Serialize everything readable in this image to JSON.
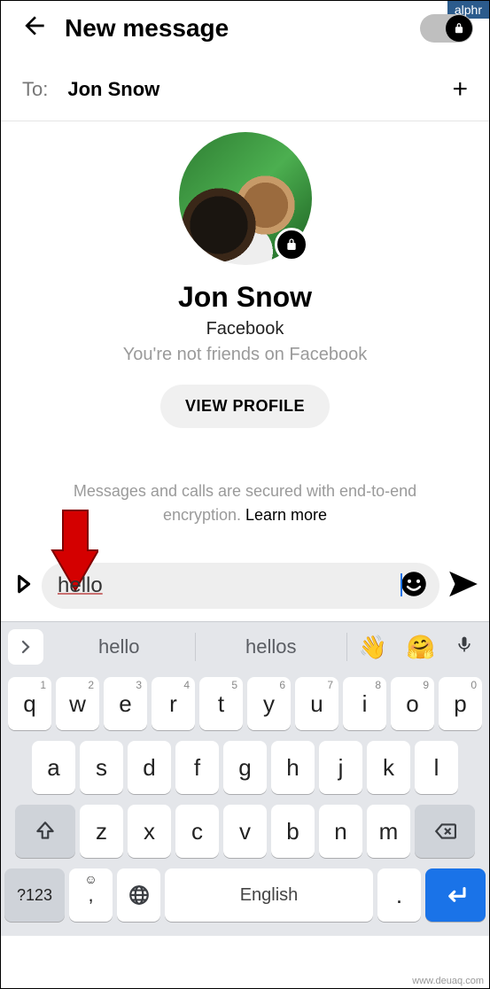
{
  "overlay": {
    "brand": "alphr",
    "watermark": "www.deuaq.com"
  },
  "header": {
    "title": "New message"
  },
  "to": {
    "label": "To:",
    "name": "Jon Snow"
  },
  "profile": {
    "name": "Jon Snow",
    "platform": "Facebook",
    "status": "You're not friends on Facebook",
    "view_profile": "VIEW PROFILE"
  },
  "encryption": {
    "text": "Messages and calls are secured with end-to-end encryption. ",
    "learn": "Learn more"
  },
  "composer": {
    "text": "hello"
  },
  "suggestions": {
    "s1": "hello",
    "s2": "hellos",
    "e1": "👋",
    "e2": "🤗"
  },
  "keys": {
    "row1": [
      "q",
      "w",
      "e",
      "r",
      "t",
      "y",
      "u",
      "i",
      "o",
      "p"
    ],
    "nums": [
      "1",
      "2",
      "3",
      "4",
      "5",
      "6",
      "7",
      "8",
      "9",
      "0"
    ],
    "row2": [
      "a",
      "s",
      "d",
      "f",
      "g",
      "h",
      "j",
      "k",
      "l"
    ],
    "row3": [
      "z",
      "x",
      "c",
      "v",
      "b",
      "n",
      "m"
    ],
    "sym": "?123",
    "comma": ",",
    "space": "English",
    "period": "."
  }
}
